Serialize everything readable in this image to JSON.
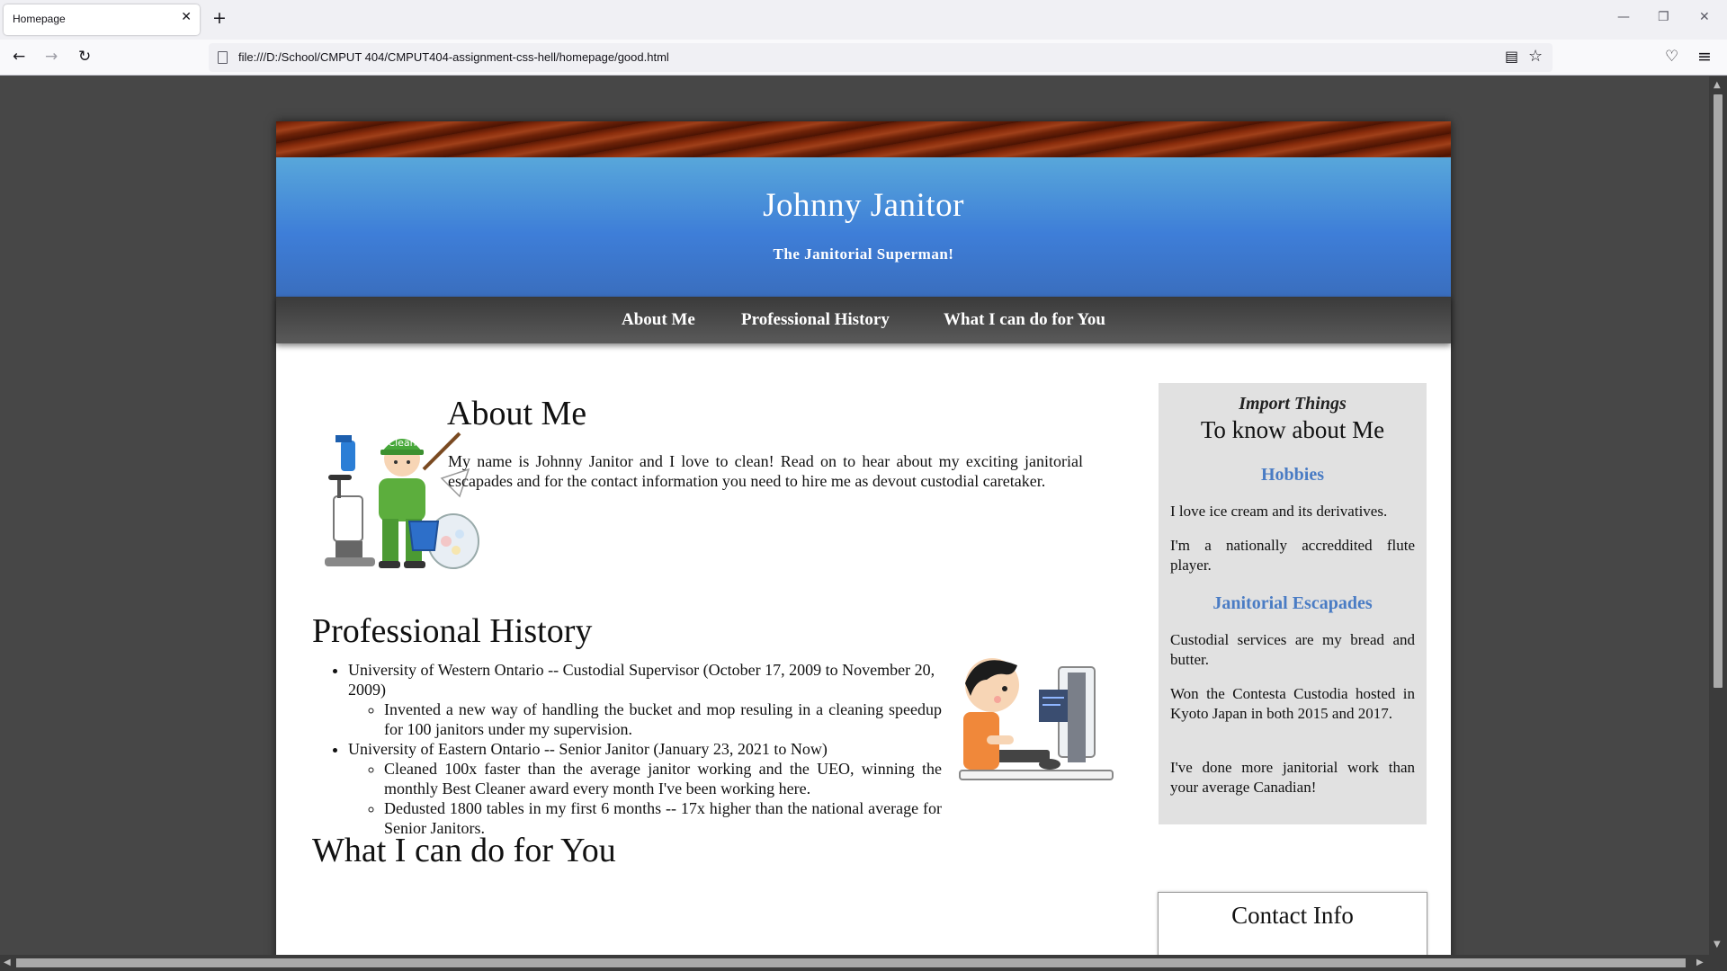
{
  "browser": {
    "tab_title": "Homepage",
    "tab_close": "✕",
    "new_tab": "+",
    "url": "file:///D:/School/CMPUT 404/CMPUT404-assignment-css-hell/homepage/good.html",
    "back_icon": "←",
    "forward_icon": "→",
    "reload_icon": "↻",
    "reader_icon": "▤",
    "bookmark_icon": "☆",
    "pocket_icon": "♡",
    "menu_icon": "≡",
    "minimize_icon": "—",
    "restore_icon": "❐",
    "close_icon": "✕"
  },
  "header": {
    "title": "Johnny Janitor",
    "subtitle": "The Janitorial Superman!"
  },
  "nav": {
    "links": [
      "About Me",
      "Professional History",
      "What I can do for You"
    ]
  },
  "about": {
    "heading": "About Me",
    "text": "My name is Johnny Janitor and I love to clean! Read on to hear about my exciting janitorial escapades and for the contact information you need to hire me as devout custodial caretaker."
  },
  "history": {
    "heading": "Professional History",
    "items": [
      {
        "title": "University of Western Ontario -- Custodial Supervisor (October 17, 2009 to November 20, 2009)",
        "details": [
          "Invented a new way of handling the bucket and mop resuling in a cleaning speedup for 100 janitors under my supervision."
        ]
      },
      {
        "title": "University of Eastern Ontario -- Senior Janitor (January 23, 2021 to Now)",
        "details": [
          "Cleaned 100x faster than the average janitor working and the UEO, winning the monthly Best Cleaner award every month I've been working here.",
          "Dedusted 1800 tables in my first 6 months -- 17x higher than the national average for Senior Janitors."
        ]
      }
    ]
  },
  "services": {
    "heading": "What I can do for You"
  },
  "sidebar": {
    "kicker": "Import Things",
    "title": "To know about Me",
    "hobbies_heading": "Hobbies",
    "hobbies": [
      "I love ice cream and its derivatives.",
      "I'm a nationally accreddited flute player."
    ],
    "escapades_heading": "Janitorial Escapades",
    "escapades": [
      "Custodial services are my bread and butter.",
      "Won the Contesta Custodia hosted in Kyoto Japan in both 2015 and 2017.",
      "I've done more janitorial work than your average Canadian!"
    ]
  },
  "contact": {
    "heading": "Contact Info"
  },
  "colors": {
    "header_top": "#58a7da",
    "header_bottom": "#3a6ebe",
    "accent_heading": "#4a7cc4",
    "page_bg": "#474747"
  }
}
